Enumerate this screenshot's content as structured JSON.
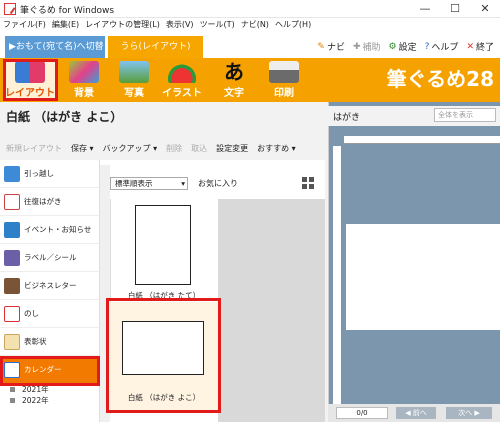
{
  "window": {
    "title": "筆ぐるめ for Windows",
    "minimize": "—",
    "maximize": "☐",
    "close": "✕"
  },
  "menu": [
    "ファイル(F)",
    "編集(E)",
    "レイアウトの管理(L)",
    "表示(V)",
    "ツール(T)",
    "ナビ(N)",
    "ヘルプ(H)"
  ],
  "tabs": {
    "front": "▶おもて(宛て名)へ切替",
    "back": "うら(レイアウト)"
  },
  "top_links": {
    "navi": "ナビ",
    "assist": "補助",
    "settings": "設定",
    "help": "ヘルプ",
    "exit": "終了"
  },
  "ribbon": {
    "items": [
      "レイアウト",
      "背景",
      "写真",
      "イラスト",
      "文字",
      "印刷"
    ],
    "brand": "筆ぐるめ28"
  },
  "document": {
    "title": "白紙 （はがき よこ）"
  },
  "toolbar": [
    "新規レイアウト",
    "保存 ▾",
    "バックアップ ▾",
    "削除",
    "取込",
    "設定変更",
    "おすすめ ▾"
  ],
  "categories": [
    "引っ越し",
    "往復はがき",
    "イベント・お知らせ",
    "ラベル／シール",
    "ビジネスレター",
    "のし",
    "表彰状",
    "カレンダー"
  ],
  "subitems": [
    "2021年",
    "2022年"
  ],
  "thumbs": {
    "sort": "標準順表示",
    "favorites": "お気に入り",
    "cards": [
      "白紙 （はがき たて）",
      "白紙 （はがき よこ）"
    ]
  },
  "preview": {
    "title": "はがき",
    "zoom": "全体を表示",
    "page": "0/0",
    "prev": "◀ 前へ",
    "next": "次へ ▶"
  },
  "colors": {
    "ribbon": "#f5a200",
    "tab_front": "#5b9bd5",
    "selected_category": "#f37a00",
    "highlight_frame": "#e31a1a"
  }
}
